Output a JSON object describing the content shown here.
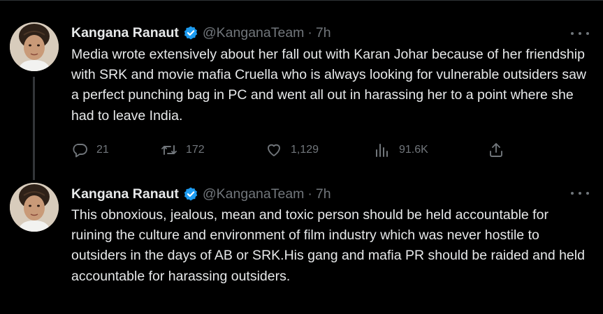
{
  "tweets": [
    {
      "author_name": "Kangana Ranaut",
      "handle": "@KanganaTeam",
      "separator": "·",
      "time": "7h",
      "text": "Media wrote extensively about her fall out with Karan Johar because of her friendship with SRK and movie mafia Cruella who is always looking for vulnerable outsiders saw a perfect punching bag in PC and went all out in harassing her to a point where she had to leave India.",
      "replies": "21",
      "retweets": "172",
      "likes": "1,129",
      "views": "91.6K"
    },
    {
      "author_name": "Kangana Ranaut",
      "handle": "@KanganaTeam",
      "separator": "·",
      "time": "7h",
      "text": "This obnoxious, jealous, mean and toxic person should be held accountable for ruining the culture and environment of film industry which was never hostile to outsiders in the days of AB or SRK.His gang and mafia PR should be raided and held accountable for harassing outsiders."
    }
  ],
  "icons": {
    "verified": "verified-badge-icon",
    "reply": "reply-icon",
    "retweet": "retweet-icon",
    "like": "heart-icon",
    "views": "views-icon",
    "share": "share-icon",
    "more": "more-icon"
  },
  "colors": {
    "background": "#000000",
    "text": "#e7e9ea",
    "muted": "#71767b",
    "verified": "#1d9bf0",
    "thread_line": "#333639"
  }
}
